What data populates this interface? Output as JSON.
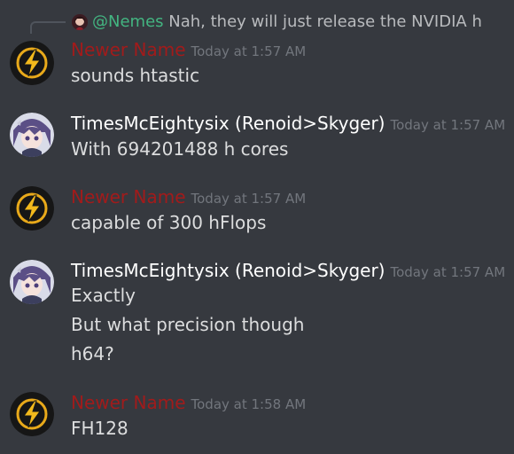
{
  "reply": {
    "mention": "@Nemes",
    "text": " Nah, they will just release the NVIDIA h"
  },
  "messages": [
    {
      "author": "Newer Name",
      "timestamp": "Today at 1:57 AM",
      "lines": [
        "sounds htastic"
      ]
    },
    {
      "author": "TimesMcEightysix (Renoid>Skyger)",
      "timestamp": "Today at 1:57 AM",
      "lines": [
        "With 694201488 h cores"
      ]
    },
    {
      "author": "Newer Name",
      "timestamp": "Today at 1:57 AM",
      "lines": [
        "capable of 300 hFlops"
      ]
    },
    {
      "author": "TimesMcEightysix (Renoid>Skyger)",
      "timestamp": "Today at 1:57 AM",
      "lines": [
        "Exactly",
        "But what precision though",
        "h64?"
      ]
    },
    {
      "author": "Newer Name",
      "timestamp": "Today at 1:58 AM",
      "lines": [
        "FH128"
      ]
    }
  ],
  "colors": {
    "background": "#36393f",
    "author_red": "#a11b1b",
    "mention_green": "#43b581"
  }
}
